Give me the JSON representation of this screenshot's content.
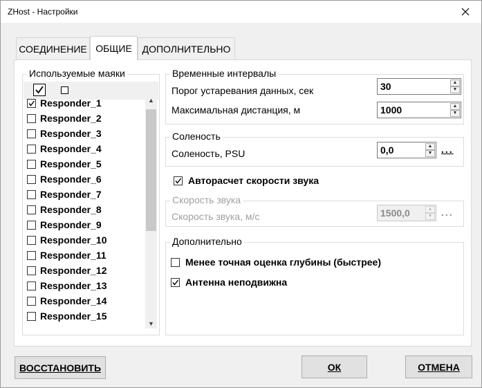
{
  "window": {
    "title": "ZHost - Настройки"
  },
  "tabs": [
    {
      "label": "СОЕДИНЕНИЕ",
      "active": false
    },
    {
      "label": "ОБЩИЕ",
      "active": true
    },
    {
      "label": "ДОПОЛНИТЕЛЬНО",
      "active": false
    }
  ],
  "beacons": {
    "title": "Используемые маяки",
    "items": [
      {
        "label": "Responder_1",
        "checked": true
      },
      {
        "label": "Responder_2",
        "checked": false
      },
      {
        "label": "Responder_3",
        "checked": false
      },
      {
        "label": "Responder_4",
        "checked": false
      },
      {
        "label": "Responder_5",
        "checked": false
      },
      {
        "label": "Responder_6",
        "checked": false
      },
      {
        "label": "Responder_7",
        "checked": false
      },
      {
        "label": "Responder_8",
        "checked": false
      },
      {
        "label": "Responder_9",
        "checked": false
      },
      {
        "label": "Responder_10",
        "checked": false
      },
      {
        "label": "Responder_11",
        "checked": false
      },
      {
        "label": "Responder_12",
        "checked": false
      },
      {
        "label": "Responder_13",
        "checked": false
      },
      {
        "label": "Responder_14",
        "checked": false
      },
      {
        "label": "Responder_15",
        "checked": false
      }
    ]
  },
  "time_intervals": {
    "title": "Временные интервалы",
    "threshold_label": "Порог устаревания данных, сек",
    "threshold_value": "30",
    "max_distance_label": "Максимальная дистанция, м",
    "max_distance_value": "1000"
  },
  "salinity": {
    "title": "Соленость",
    "label": "Соленость, PSU",
    "value": "0,0",
    "dots": "..."
  },
  "auto_sound_speed": {
    "label": "Авторасчет скорости звука",
    "checked": true
  },
  "sound_speed": {
    "title": "Скорость звука",
    "label": "Скорость звука, м/с",
    "value": "1500,0",
    "dots": "..."
  },
  "additional": {
    "title": "Дополнительно",
    "less_precise_label": "Менее точная оценка глубины (быстрее)",
    "less_precise_checked": false,
    "antenna_fixed_label": "Антенна неподвижна",
    "antenna_fixed_checked": true
  },
  "buttons": {
    "restore": "ВОССТАНОВИТЬ",
    "ok": "ОК",
    "cancel": "ОТМЕНА"
  }
}
